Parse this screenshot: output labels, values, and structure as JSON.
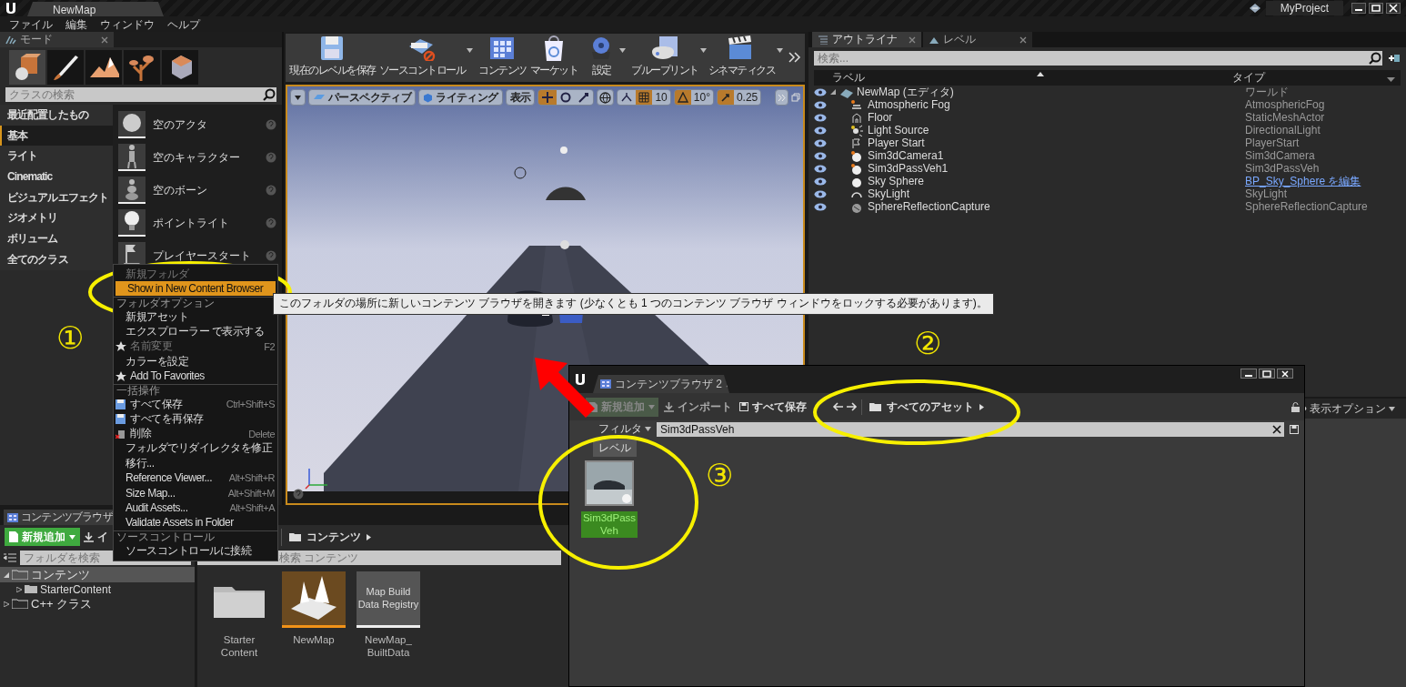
{
  "window": {
    "document_tab": "NewMap",
    "project": "MyProject"
  },
  "menu": [
    {
      "label": "ファイル"
    },
    {
      "label": "編集"
    },
    {
      "label": "ウィンドウ"
    },
    {
      "label": "ヘルプ"
    }
  ],
  "modes_panel": {
    "tab": "モード",
    "mode_tabs": [
      {
        "kind": "place",
        "selected": true
      },
      {
        "kind": "paint",
        "selected": false
      },
      {
        "kind": "landscape",
        "selected": false
      },
      {
        "kind": "foliage",
        "selected": false
      },
      {
        "kind": "geometry",
        "selected": false
      }
    ],
    "search_placeholder": "クラスの検索",
    "categories": [
      {
        "label": "最近配置したもの",
        "selected": false
      },
      {
        "label": "基本",
        "selected": true
      },
      {
        "label": "ライト",
        "selected": false
      },
      {
        "label": "Cinematic",
        "selected": false
      },
      {
        "label": "ビジュアルエフェクト",
        "selected": false
      },
      {
        "label": "ジオメトリ",
        "selected": false
      },
      {
        "label": "ボリューム",
        "selected": false
      },
      {
        "label": "全てのクラス",
        "selected": false
      }
    ],
    "items": [
      {
        "kind": "sphere",
        "label": "空のアクタ"
      },
      {
        "kind": "character",
        "label": "空のキャラクター"
      },
      {
        "kind": "bone",
        "label": "空のボーン"
      },
      {
        "kind": "bulb",
        "label": "ポイントライト"
      },
      {
        "kind": "flag",
        "label": "プレイヤースタート"
      }
    ]
  },
  "toolbar": [
    {
      "kind": "save",
      "label": "現在のレベルを保存",
      "has_menu": false
    },
    {
      "kind": "source_control",
      "label": "ソースコントロール",
      "has_menu": true
    },
    {
      "kind": "content",
      "label": "コンテンツ",
      "has_menu": false
    },
    {
      "kind": "marketplace",
      "label": "マーケット",
      "has_menu": false
    },
    {
      "kind": "settings",
      "label": "設定",
      "has_menu": true
    },
    {
      "kind": "blueprint",
      "label": "ブループリント",
      "has_menu": true
    },
    {
      "kind": "cinematics",
      "label": "シネマティクス",
      "has_menu": true
    }
  ],
  "viewport": {
    "view_mode": "パースペクティブ",
    "lighting": "ライティング",
    "show": "表示",
    "grid_snap": "10",
    "rotation_snap": "10°",
    "scale_snap": "0.25"
  },
  "outliner": {
    "tabs": [
      {
        "label": "アウトライナ",
        "selected": true
      },
      {
        "label": "レベル",
        "selected": false
      }
    ],
    "search_placeholder": "検索...",
    "columns": [
      "ラベル",
      "タイプ"
    ],
    "rows": [
      {
        "kind": "world",
        "label": "NewMap (エディタ)",
        "type": "ワールド",
        "type_link": false,
        "expanded": true,
        "children": [
          {
            "kind": "fog",
            "label": "Atmospheric Fog",
            "type": "AtmosphericFog",
            "type_link": false
          },
          {
            "kind": "mesh",
            "label": "Floor",
            "type": "StaticMeshActor",
            "type_link": false
          },
          {
            "kind": "light",
            "label": "Light Source",
            "type": "DirectionalLight",
            "type_link": false
          },
          {
            "kind": "player",
            "label": "Player Start",
            "type": "PlayerStart",
            "type_link": false
          },
          {
            "kind": "actor",
            "label": "Sim3dCamera1",
            "type": "Sim3dCamera",
            "type_link": false
          },
          {
            "kind": "actor",
            "label": "Sim3dPassVeh1",
            "type": "Sim3dPassVeh",
            "type_link": false
          },
          {
            "kind": "sphere",
            "label": "Sky Sphere",
            "type": "BP_Sky_Sphere を編集",
            "type_link": true
          },
          {
            "kind": "skylight",
            "label": "SkyLight",
            "type": "SkyLight",
            "type_link": false
          },
          {
            "kind": "capture",
            "label": "SphereReflectionCapture",
            "type": "SphereReflectionCapture",
            "type_link": false
          }
        ]
      }
    ]
  },
  "details": {
    "view_options": "表示オプション"
  },
  "context_menu": {
    "sections": [
      {
        "items": [
          {
            "label": "新規フォルダ",
            "disabled": true,
            "highlighted": false
          },
          {
            "label": "Show in New Content Browser",
            "disabled": false,
            "highlighted": true
          }
        ]
      },
      {
        "heading": "フォルダオプション",
        "items": [
          {
            "label": "新規アセット",
            "disabled": false,
            "highlighted": false
          },
          {
            "label": "エクスプローラー で表示する",
            "disabled": false,
            "highlighted": false
          },
          {
            "label": "名前変更",
            "shortcut": "F2",
            "disabled": true,
            "highlighted": false,
            "kind": "star"
          },
          {
            "label": "カラーを設定",
            "disabled": false,
            "highlighted": false
          },
          {
            "label": "Add To Favorites",
            "disabled": false,
            "highlighted": false,
            "kind": "star"
          }
        ]
      },
      {
        "heading": "一括操作",
        "items": [
          {
            "label": "すべて保存",
            "shortcut": "Ctrl+Shift+S",
            "disabled": false,
            "highlighted": false,
            "kind": "save"
          },
          {
            "label": "すべてを再保存",
            "disabled": false,
            "highlighted": false,
            "kind": "save"
          },
          {
            "label": "削除",
            "shortcut": "Delete",
            "disabled": false,
            "highlighted": false,
            "kind": "delete"
          },
          {
            "label": "フォルダでリダイレクタを修正",
            "disabled": false,
            "highlighted": false
          },
          {
            "label": "移行...",
            "disabled": false,
            "highlighted": false
          },
          {
            "label": "Reference Viewer...",
            "shortcut": "Alt+Shift+R",
            "disabled": false,
            "highlighted": false
          },
          {
            "label": "Size Map...",
            "shortcut": "Alt+Shift+M",
            "disabled": false,
            "highlighted": false
          },
          {
            "label": "Audit Assets...",
            "shortcut": "Alt+Shift+A",
            "disabled": false,
            "highlighted": false
          },
          {
            "label": "Validate Assets in Folder",
            "disabled": false,
            "highlighted": false
          }
        ]
      },
      {
        "heading": "ソースコントロール",
        "items": [
          {
            "label": "ソースコントロールに接続",
            "disabled": false,
            "highlighted": false
          }
        ]
      }
    ]
  },
  "tooltip": "このフォルダの場所に新しいコンテンツ ブラウザを開きます (少なくとも 1 つのコンテンツ ブラウザ ウィンドウをロックする必要があります)。",
  "content_browser": {
    "tab": "コンテンツブラウザ",
    "add_button": "新規追加",
    "import_button": "イ",
    "path": "コンテンツ",
    "folder_search_placeholder": "フォルダを検索",
    "asset_search_placeholder": "検索 コンテンツ",
    "folders": [
      {
        "label": "コンテンツ",
        "selected": true,
        "expanded": true,
        "children": [
          {
            "label": "StarterContent",
            "selected": false,
            "expanded": false
          }
        ]
      },
      {
        "label": "C++ クラス",
        "selected": false,
        "expanded": false
      }
    ],
    "assets": [
      {
        "kind": "folder",
        "label": "Starter Content"
      },
      {
        "kind": "level",
        "label": "NewMap"
      },
      {
        "kind": "data",
        "label": "NewMap_ BuiltData",
        "thumbnail_text": "Map Build Data Registry"
      }
    ]
  },
  "content_browser_2": {
    "tab": "コンテンツブラウザ 2",
    "add_button": "新規追加",
    "import_button": "インポート",
    "save_all_button": "すべて保存",
    "path": "すべてのアセット",
    "filter_button": "フィルタ",
    "search_value": "Sim3dPassVeh",
    "filter_chips": [
      {
        "label": "レベル"
      }
    ],
    "assets": [
      {
        "kind": "blueprint",
        "label": "Sim3dPass Veh",
        "highlighted": true
      }
    ]
  },
  "annotations": {
    "markers": [
      {
        "label": "①"
      },
      {
        "label": "②"
      },
      {
        "label": "③"
      }
    ]
  }
}
